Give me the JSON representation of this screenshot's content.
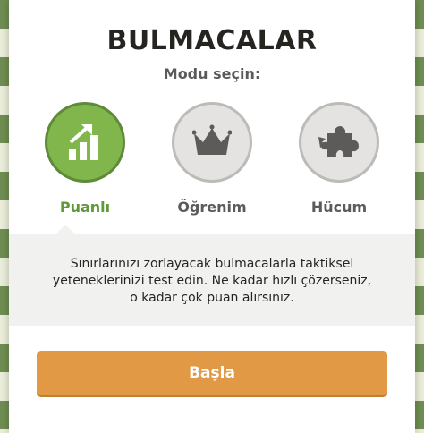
{
  "modal": {
    "title": "BULMACALAR",
    "subtitle": "Modu seçin:"
  },
  "modes": [
    {
      "label": "Puanlı",
      "icon": "chart-bars-arrow-icon",
      "selected": true
    },
    {
      "label": "Öğrenim",
      "icon": "crown-icon",
      "selected": false
    },
    {
      "label": "Hücum",
      "icon": "puzzle-piece-icon",
      "selected": false
    }
  ],
  "description": {
    "line1": "Sınırlarınızı zorlayacak bulmacalarla taktiksel",
    "line2": "yeteneklerinizi test edin. Ne kadar hızlı çözerseniz,",
    "line3": "o kadar çok puan alırsınız."
  },
  "start_button": {
    "label": "Başla"
  },
  "colors": {
    "accent_green": "#81b64c",
    "button_orange": "#e29945",
    "text_dark": "#262421",
    "icon_gray": "#5d5b59"
  }
}
